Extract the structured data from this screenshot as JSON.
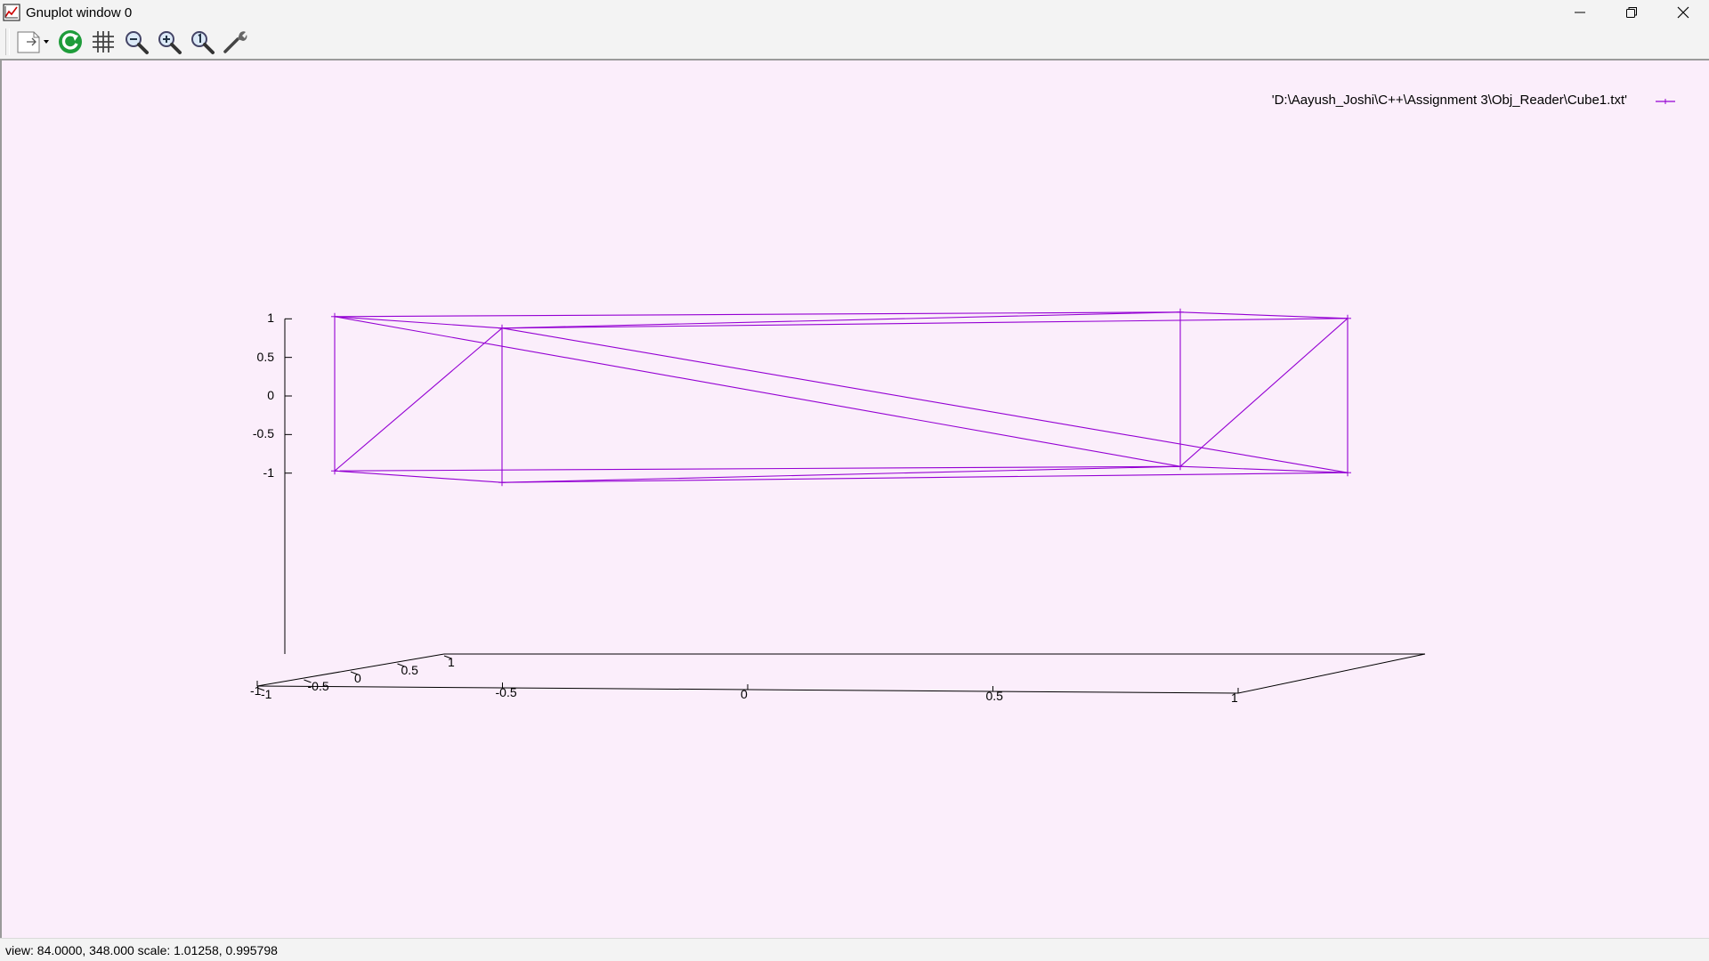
{
  "window": {
    "title": "Gnuplot window 0",
    "controls": [
      "minimize-icon",
      "restore-icon",
      "close-icon"
    ]
  },
  "toolbar": {
    "buttons": [
      {
        "icon": "print-menu-icon",
        "tooltip": ""
      },
      {
        "icon": "replot-icon"
      },
      {
        "icon": "grid-icon"
      },
      {
        "icon": "zoom-out-icon"
      },
      {
        "icon": "zoom-in-icon"
      },
      {
        "icon": "autoscale-icon"
      },
      {
        "icon": "options-icon"
      }
    ]
  },
  "plot": {
    "legend": "'D:\\Aayush_Joshi\\C++\\Assignment 3\\Obj_Reader\\Cube1.txt'",
    "line_color": "#9400d3",
    "background": "#fbeefb"
  },
  "chart_data": {
    "type": "line",
    "mode": "splot 3D wireframe",
    "series": [
      {
        "name": "'D:\\Aayush_Joshi\\C++\\Assignment 3\\Obj_Reader\\Cube1.txt'",
        "vertices": [
          [
            -1,
            1,
            1
          ],
          [
            -1,
            -1,
            1
          ],
          [
            1,
            -1,
            1
          ],
          [
            1,
            1,
            1
          ],
          [
            -1,
            1,
            -1
          ],
          [
            -1,
            -1,
            -1
          ],
          [
            1,
            -1,
            -1
          ],
          [
            1,
            1,
            -1
          ]
        ]
      }
    ],
    "z_ticks": [
      "1",
      "0.5",
      "0",
      "-0.5",
      "-1"
    ],
    "x_ticks": [
      "-1",
      "-0.5",
      "0",
      "0.5",
      "1"
    ],
    "y_ticks": [
      "1",
      "0.5",
      "0",
      "-0.5",
      "-1"
    ],
    "zlim": [
      -1,
      1
    ],
    "xlim": [
      -1,
      1
    ],
    "ylim": [
      -1,
      1
    ],
    "view": [
      84,
      348
    ],
    "scale": [
      1.01258,
      0.995798
    ],
    "legend_position": "top-right",
    "grid": false
  },
  "status": {
    "text": "view: 84.0000,  348.000   scale: 1.01258,  0.995798"
  }
}
